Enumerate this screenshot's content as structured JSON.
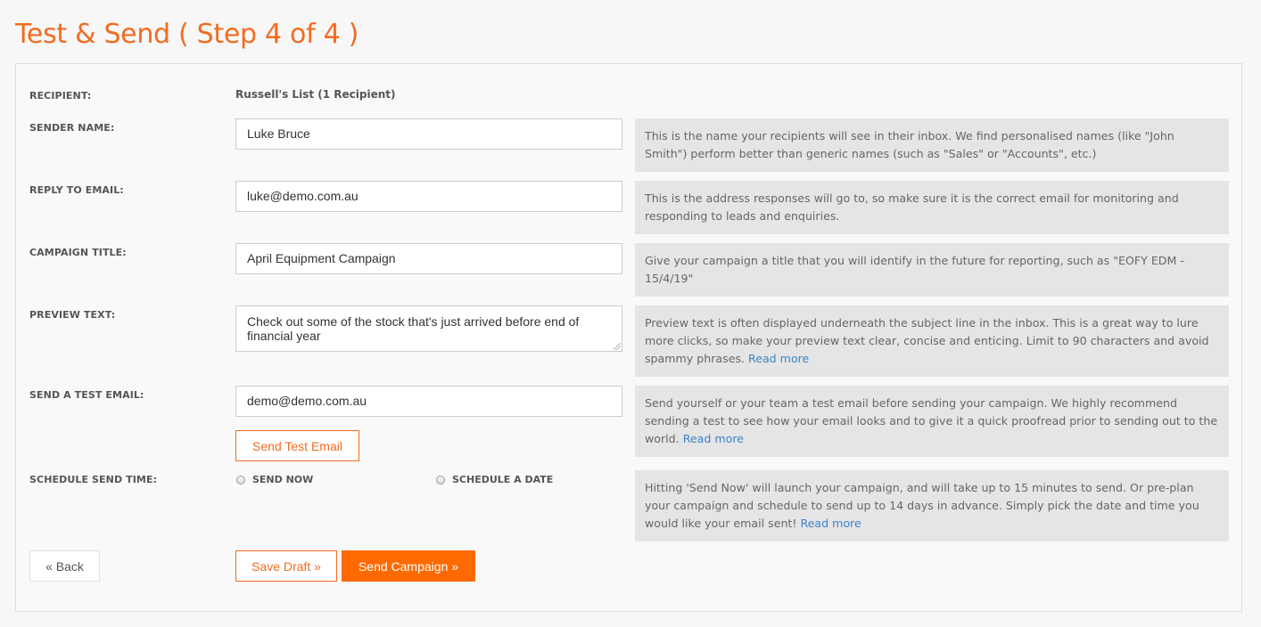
{
  "page": {
    "title": "Test & Send ( Step 4 of 4 )"
  },
  "form": {
    "recipient": {
      "label": "RECIPIENT:",
      "value": "Russell's List (1 Recipient)"
    },
    "sender_name": {
      "label": "SENDER NAME:",
      "value": "Luke Bruce",
      "help": "This is the name your recipients will see in their inbox. We find personalised names (like \"John Smith\") perform better than generic names (such as \"Sales\" or \"Accounts\", etc.)"
    },
    "reply_to": {
      "label": "REPLY TO EMAIL:",
      "value": "luke@demo.com.au",
      "help": "This is the address responses will go to, so make sure it is the correct email for monitoring and responding to leads and enquiries."
    },
    "campaign_title": {
      "label": "CAMPAIGN TITLE:",
      "value": "April Equipment Campaign",
      "help": "Give your campaign a title that you will identify in the future for reporting, such as \"EOFY EDM - 15/4/19\""
    },
    "preview_text": {
      "label": "PREVIEW TEXT:",
      "value": "Check out some of the stock that's just arrived before end of financial year",
      "help": "Preview text is often displayed underneath the subject line in the inbox. This is a great way to lure more clicks, so make your preview text clear, concise and enticing. Limit to 90 characters and avoid spammy phrases.",
      "link": "Read more"
    },
    "test_email": {
      "label": "SEND A TEST EMAIL:",
      "value": "demo@demo.com.au",
      "button": "Send Test Email",
      "help": "Send yourself or your team a test email before sending your campaign. We highly recommend sending a test to see how your email looks and to give it a quick proofread prior to sending out to the world.",
      "link": "Read more"
    },
    "schedule": {
      "label": "SCHEDULE SEND TIME:",
      "option_now": "SEND NOW",
      "option_date": "SCHEDULE A DATE",
      "help": "Hitting 'Send Now' will launch your campaign, and will take up to 15 minutes to send. Or pre-plan your campaign and schedule to send up to 14 days in advance. Simply pick the date and time you would like your email sent!",
      "link": "Read more"
    }
  },
  "actions": {
    "back": "« Back",
    "save_draft": "Save Draft »",
    "send_campaign": "Send Campaign »"
  },
  "colors": {
    "accent": "#f26c21",
    "primary_button": "#ff6a00",
    "link": "#3c84c9",
    "help_bg": "#e5e5e5"
  }
}
